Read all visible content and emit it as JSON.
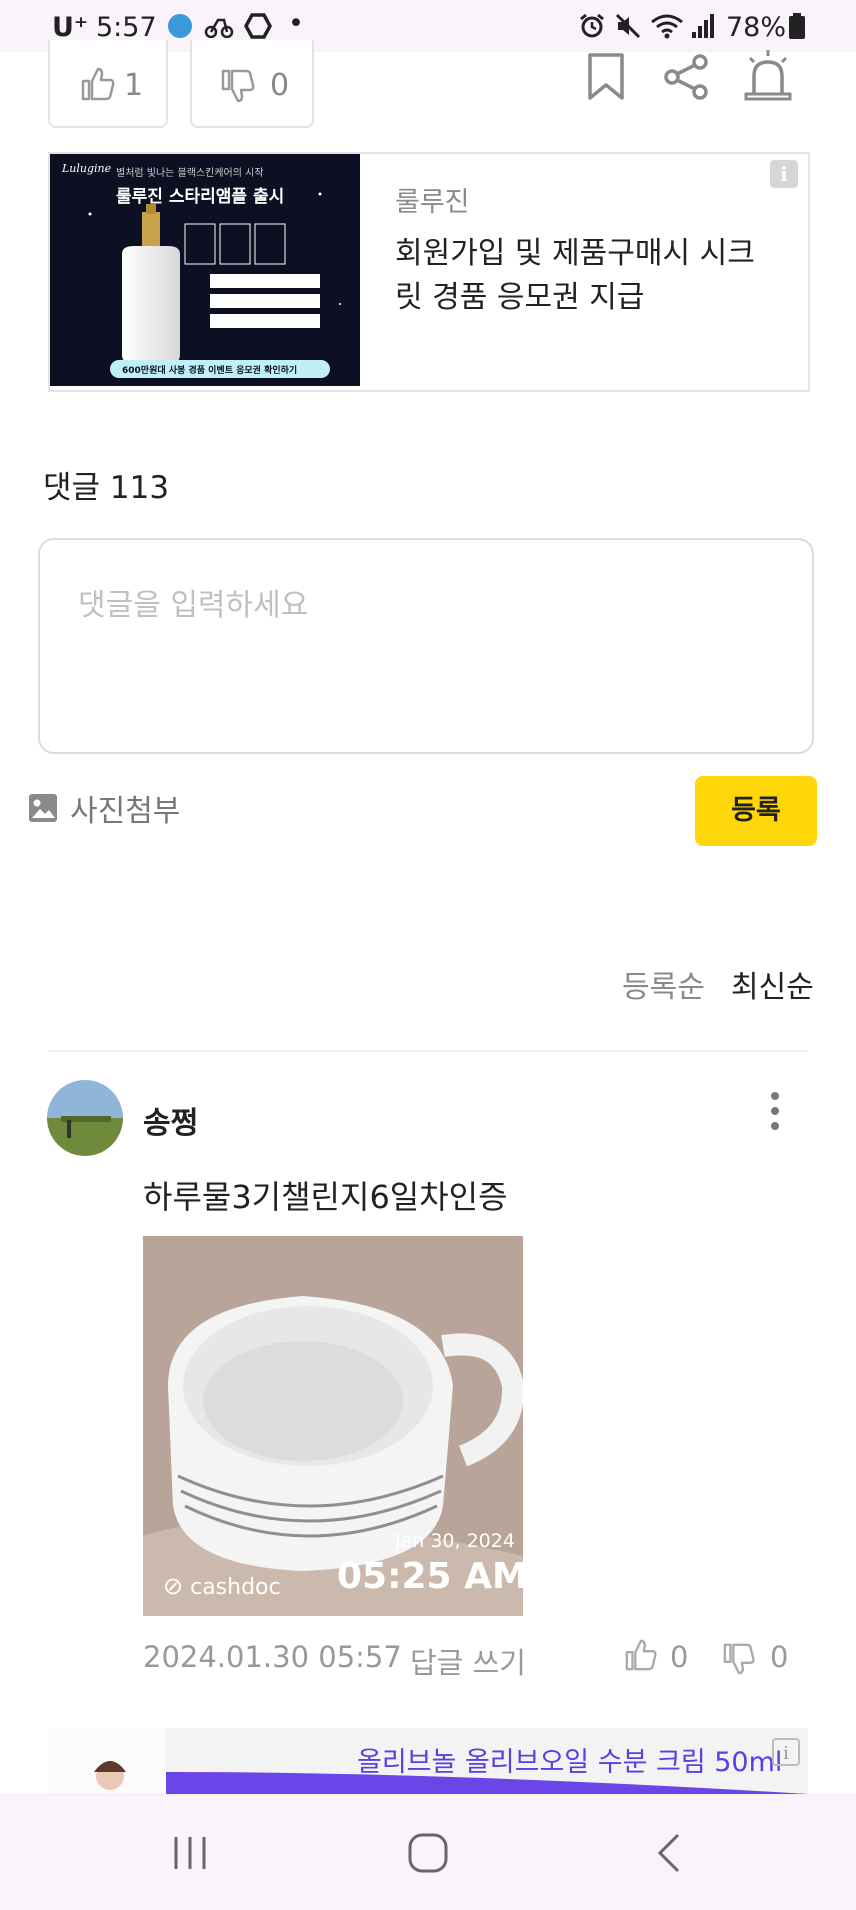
{
  "status_bar": {
    "carrier": "U⁺",
    "time": "5:57",
    "dot": "•",
    "battery": "78%"
  },
  "reactions": {
    "like_count": "1",
    "dislike_count": "0"
  },
  "ad": {
    "image_brand": "Lulugine",
    "image_tagline": "별처럼 빛나는 블랙스킨케어의 시작",
    "image_headline": "룰루진 스타리앰플 출시",
    "image_cta": "600만원대 사봉 경품 이벤트 응모권 확인하기",
    "brand": "룰루진",
    "description": "회원가입 및 제품구매시 시크릿 경품 응모권 지급",
    "info_label": "i"
  },
  "comments": {
    "count_label": "댓글 113",
    "input_placeholder": "댓글을 입력하세요",
    "attach_label": "사진첨부",
    "submit_label": "등록",
    "sort_options": [
      "등록순",
      "최신순"
    ],
    "active_sort": "최신순"
  },
  "comment_item": {
    "author": "송쩡",
    "text": "하루물3기챌린지6일차인증",
    "photo_date": "Jan 30, 2024",
    "photo_time": "05:25 AM",
    "photo_brand": "cashdoc",
    "timestamp": "2024.01.30 05:57",
    "reply_label": "답글 쓰기",
    "like_count": "0",
    "dislike_count": "0"
  },
  "ad2": {
    "title": "올리브놀 올리브오일 수분 크림 50ml",
    "info_label": "i"
  },
  "colors": {
    "accent_yellow": "#ffd60a",
    "ad2_purple": "#5b3fe0",
    "statusbar_bg": "#fbf3fb"
  }
}
